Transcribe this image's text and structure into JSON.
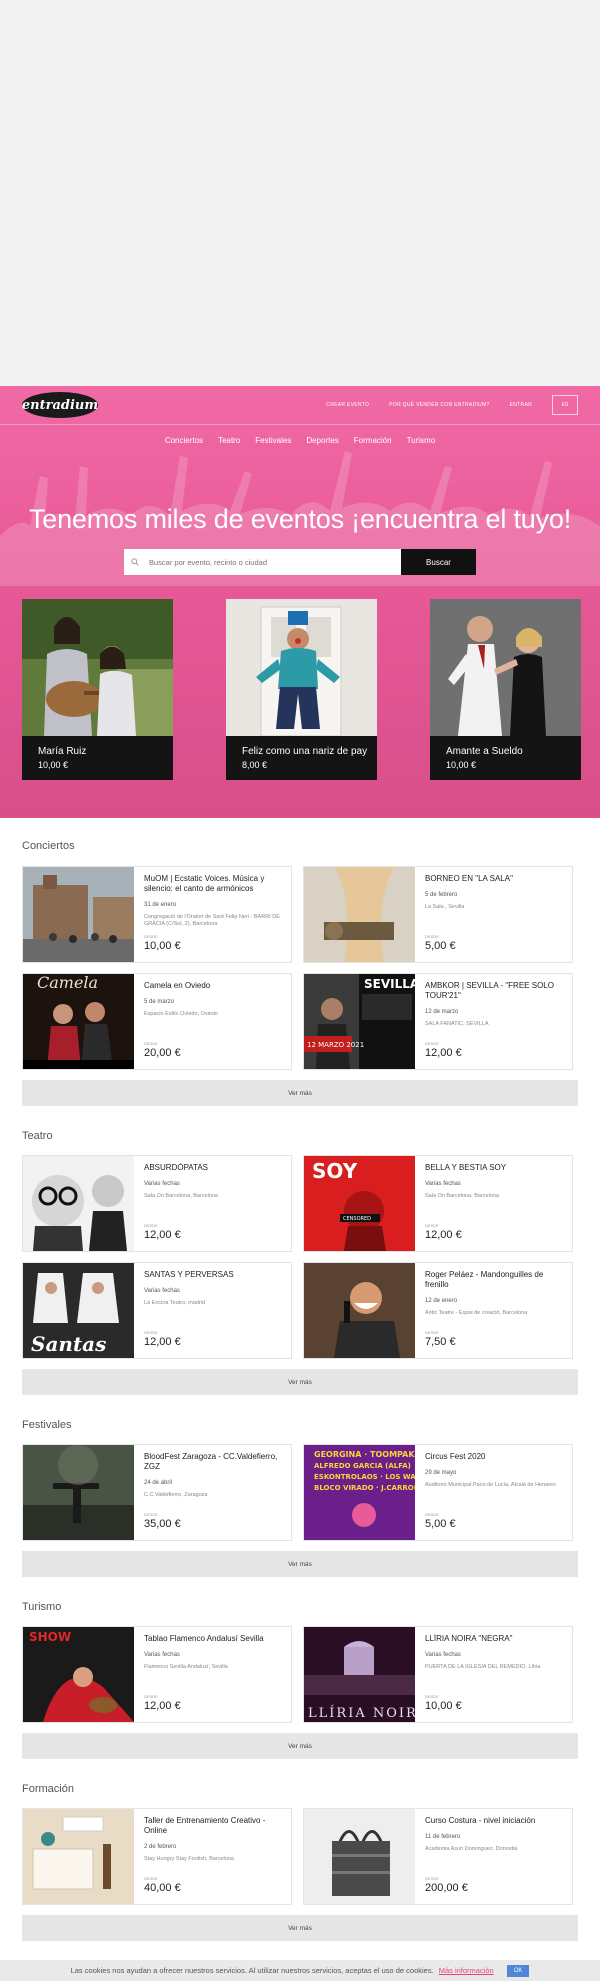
{
  "header": {
    "logo_text": "entradium",
    "links": [
      "CREAR EVENTO",
      "POR QUÉ VENDER CON ENTRADIUM?",
      "ENTRAR"
    ],
    "lang": "ES"
  },
  "nav": [
    "Conciertos",
    "Teatro",
    "Festivales",
    "Deportes",
    "Formación",
    "Turismo"
  ],
  "hero": {
    "title": "Tenemos miles de eventos ¡encuentra el tuyo!",
    "search_placeholder": "Buscar por evento, recinto o ciudad",
    "search_button": "Buscar"
  },
  "featured": [
    {
      "name": "María Ruiz",
      "price": "10,00 €"
    },
    {
      "name": "Feliz como una nariz de payaso",
      "price": "8,00 €"
    },
    {
      "name": "Amante a Sueldo",
      "price": "10,00 €"
    }
  ],
  "price_label": "DESDE",
  "sections": [
    {
      "title": "Conciertos",
      "more": "Ver más",
      "events": [
        {
          "title": "MuOM | Ecstatic Voices. Música y silencio: el canto de armónicos",
          "date": "31 de enero",
          "venue": "Congregació de l'Oratori de Sant Felip Neri - BARRI DE GRÀCIA (C/Sol, 2), Barcelona",
          "price": "10,00 €"
        },
        {
          "title": "BORNEO EN \"LA SALA\"",
          "date": "5 de febrero",
          "venue": "La Sala , Sevilla",
          "price": "5,00 €"
        },
        {
          "title": "Camela en Oviedo",
          "date": "5 de marzo",
          "venue": "Espacio Estilo Oviedo, Oviedo",
          "price": "20,00 €"
        },
        {
          "title": "AMBKOR | SEVILLA - \"FREE SOLO TOUR'21\"",
          "date": "12 de marzo",
          "venue": "SALA FANATIC, SEVILLA",
          "price": "12,00 €"
        }
      ]
    },
    {
      "title": "Teatro",
      "more": "Ver más",
      "events": [
        {
          "title": "ABSURDÓPATAS",
          "date": "Varias fechas",
          "venue": "Sala On Barcelona, Barcelona",
          "price": "12,00 €"
        },
        {
          "title": "BELLA Y BESTIA SOY",
          "date": "Varias fechas",
          "venue": "Sala On Barcelona, Barcelona",
          "price": "12,00 €"
        },
        {
          "title": "SANTAS Y PERVERSAS",
          "date": "Varias fechas",
          "venue": "La Encina Teatro, madrid",
          "price": "12,00 €"
        },
        {
          "title": "Roger Peláez - Mandonguilles de frenillo",
          "date": "12 de enero",
          "venue": "Antic Teatre - Espai de creació, Barcelona",
          "price": "7,50 €"
        }
      ]
    },
    {
      "title": "Festivales",
      "more": "Ver más",
      "events": [
        {
          "title": "BloodFest Zaragoza - CC.Valdefierro, ZGZ",
          "date": "24 de abril",
          "venue": "C.C Valdefierro, Zaragoza",
          "price": "35,00 €"
        },
        {
          "title": "Circus Fest 2020",
          "date": "29 de mayo",
          "venue": "Auditorio Municipal Paco de Lucía, Alcalá de Henares",
          "price": "5,00 €"
        }
      ]
    },
    {
      "title": "Turismo",
      "more": "Ver más",
      "events": [
        {
          "title": "Tablao Flamenco Andalusí Sevilla",
          "date": "Varias fechas",
          "venue": "Flamenco Sevilla Andalusí, Sevilla",
          "price": "12,00 €"
        },
        {
          "title": "LLÍRIA NOIRA \"NEGRA\"",
          "date": "Varias fechas",
          "venue": "PUERTA DE LA IGLESIA DEL REMEDIO, Llíria",
          "price": "10,00 €"
        }
      ]
    },
    {
      "title": "Formación",
      "more": "Ver más",
      "events": [
        {
          "title": "Taller de Entrenamiento Creativo - Online",
          "date": "2 de febrero",
          "venue": "Stay Hungry Stay Foolish, Barcelona",
          "price": "40,00 €"
        },
        {
          "title": "Curso Costura - nivel iniciación",
          "date": "11 de febrero",
          "venue": "Academia Asun Dominguez, Donostia",
          "price": "200,00 €"
        }
      ]
    }
  ],
  "cookie": {
    "text": "Las cookies nos ayudan a ofrecer nuestros servicios. Al utilizar nuestros servicios, aceptas el uso de cookies.",
    "link": "Más información",
    "ok": "OK"
  },
  "colors": {
    "brand_pink": "#e85a98",
    "button_dark": "#111111",
    "link_pink": "#e2447f",
    "ok_blue": "#4d87d6"
  }
}
